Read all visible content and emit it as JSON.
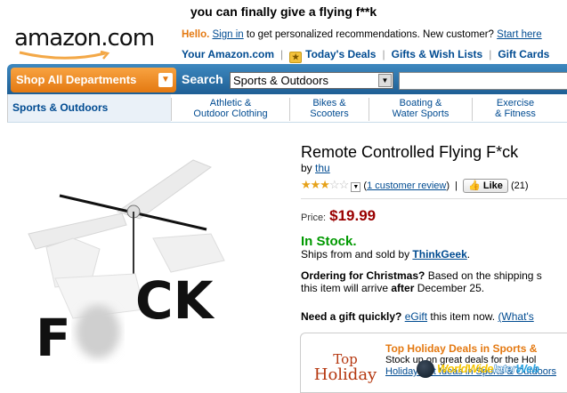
{
  "caption": "you can finally give a flying f**k",
  "logo": "amazon.com",
  "header": {
    "hello": "Hello.",
    "sign_in": "Sign in",
    "personalized": "to get personalized recommendations. New customer?",
    "start_here": "Start here"
  },
  "toplinks": {
    "your_amazon": "Your Amazon.com",
    "todays_deals": "Today's Deals",
    "gift_lists": "Gifts & Wish Lists",
    "gift_cards": "Gift Cards"
  },
  "nav": {
    "shop_all": "Shop All Departments",
    "search_label": "Search",
    "search_category": "Sports & Outdoors",
    "search_value": ""
  },
  "subnav": {
    "current": "Sports & Outdoors",
    "items": [
      {
        "line1": "Athletic &",
        "line2": "Outdoor Clothing"
      },
      {
        "line1": "Bikes &",
        "line2": "Scooters"
      },
      {
        "line1": "Boating &",
        "line2": "Water Sports"
      },
      {
        "line1": "Exercise",
        "line2": "& Fitness"
      }
    ]
  },
  "product": {
    "title": "Remote Controlled Flying F*ck",
    "by_label": "by",
    "author": "thu",
    "rating": 3,
    "rating_max": 5,
    "review_link": "1 customer review",
    "like_label": "Like",
    "like_count": "(21)",
    "price_label": "Price:",
    "price": "$19.99",
    "stock": "In Stock.",
    "ships_text": "Ships from and sold by",
    "seller": "ThinkGeek",
    "ordering_bold": "Ordering for Christmas?",
    "ordering_text": "Based on the shipping s",
    "ordering_line2_a": "this item will arrive",
    "ordering_line2_b": "after",
    "ordering_line2_c": "December 25.",
    "gift_bold": "Need a gift quickly?",
    "egift": "eGift",
    "gift_text": "this item now.",
    "whats": "(What's",
    "image_letters_left": "F",
    "image_letters_right": "CK"
  },
  "deals": {
    "badge_top": "Top",
    "badge_bottom": "Holiday",
    "heading": "Top Holiday Deals in Sports &",
    "line1": "Stock up on great deals for the Hol",
    "line2": "Holiday Gift Ideas in Sports & Outdoors"
  },
  "watermark": {
    "part1": "World",
    "part2": "Wide",
    "part3": "Inter",
    "part4": "Web"
  },
  "colors": {
    "accent_orange": "#e47911",
    "link_blue": "#004b91",
    "price_red": "#990000",
    "stock_green": "#009900",
    "nav_blue": "#1f5f95"
  }
}
